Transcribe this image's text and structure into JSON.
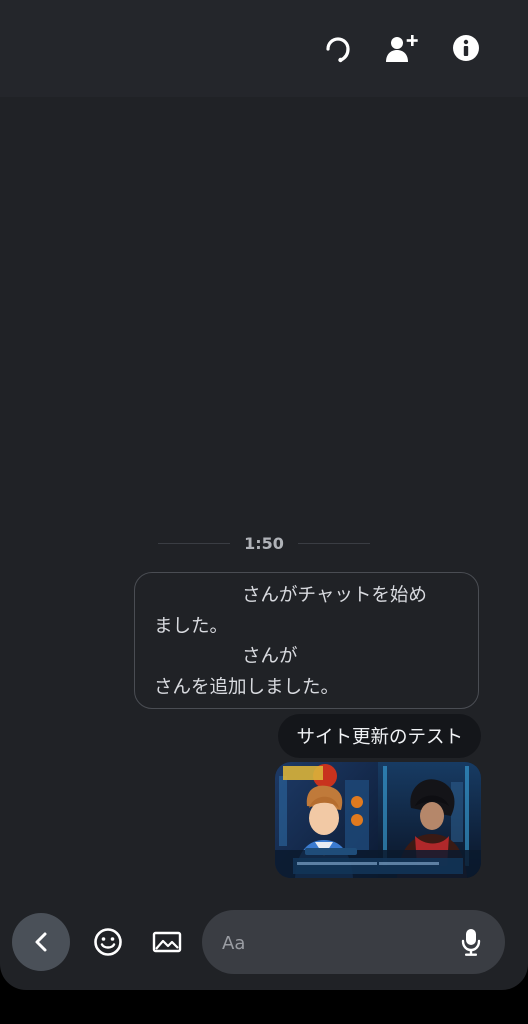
{
  "header": {
    "icons": [
      "headset-icon",
      "add-person-icon",
      "info-icon"
    ]
  },
  "chat": {
    "timestamp": "1:50",
    "system_message": {
      "line1": "さんがチャットを始め",
      "line2": "ました。",
      "line3": "さんが",
      "line4": "さんを追加しました。"
    },
    "messages": [
      {
        "type": "text",
        "text": "サイト更新のテスト"
      },
      {
        "type": "image",
        "description_icon": "anime-screenshot-image"
      }
    ]
  },
  "composer": {
    "placeholder": "Aa",
    "icons": [
      "back-chevron-icon",
      "emoji-icon",
      "gallery-icon",
      "mic-icon"
    ]
  },
  "colors": {
    "background": "#202226",
    "header": "#24262b",
    "bubble": "#14161a",
    "input": "#3a3d43",
    "back_button": "#4a5058"
  }
}
